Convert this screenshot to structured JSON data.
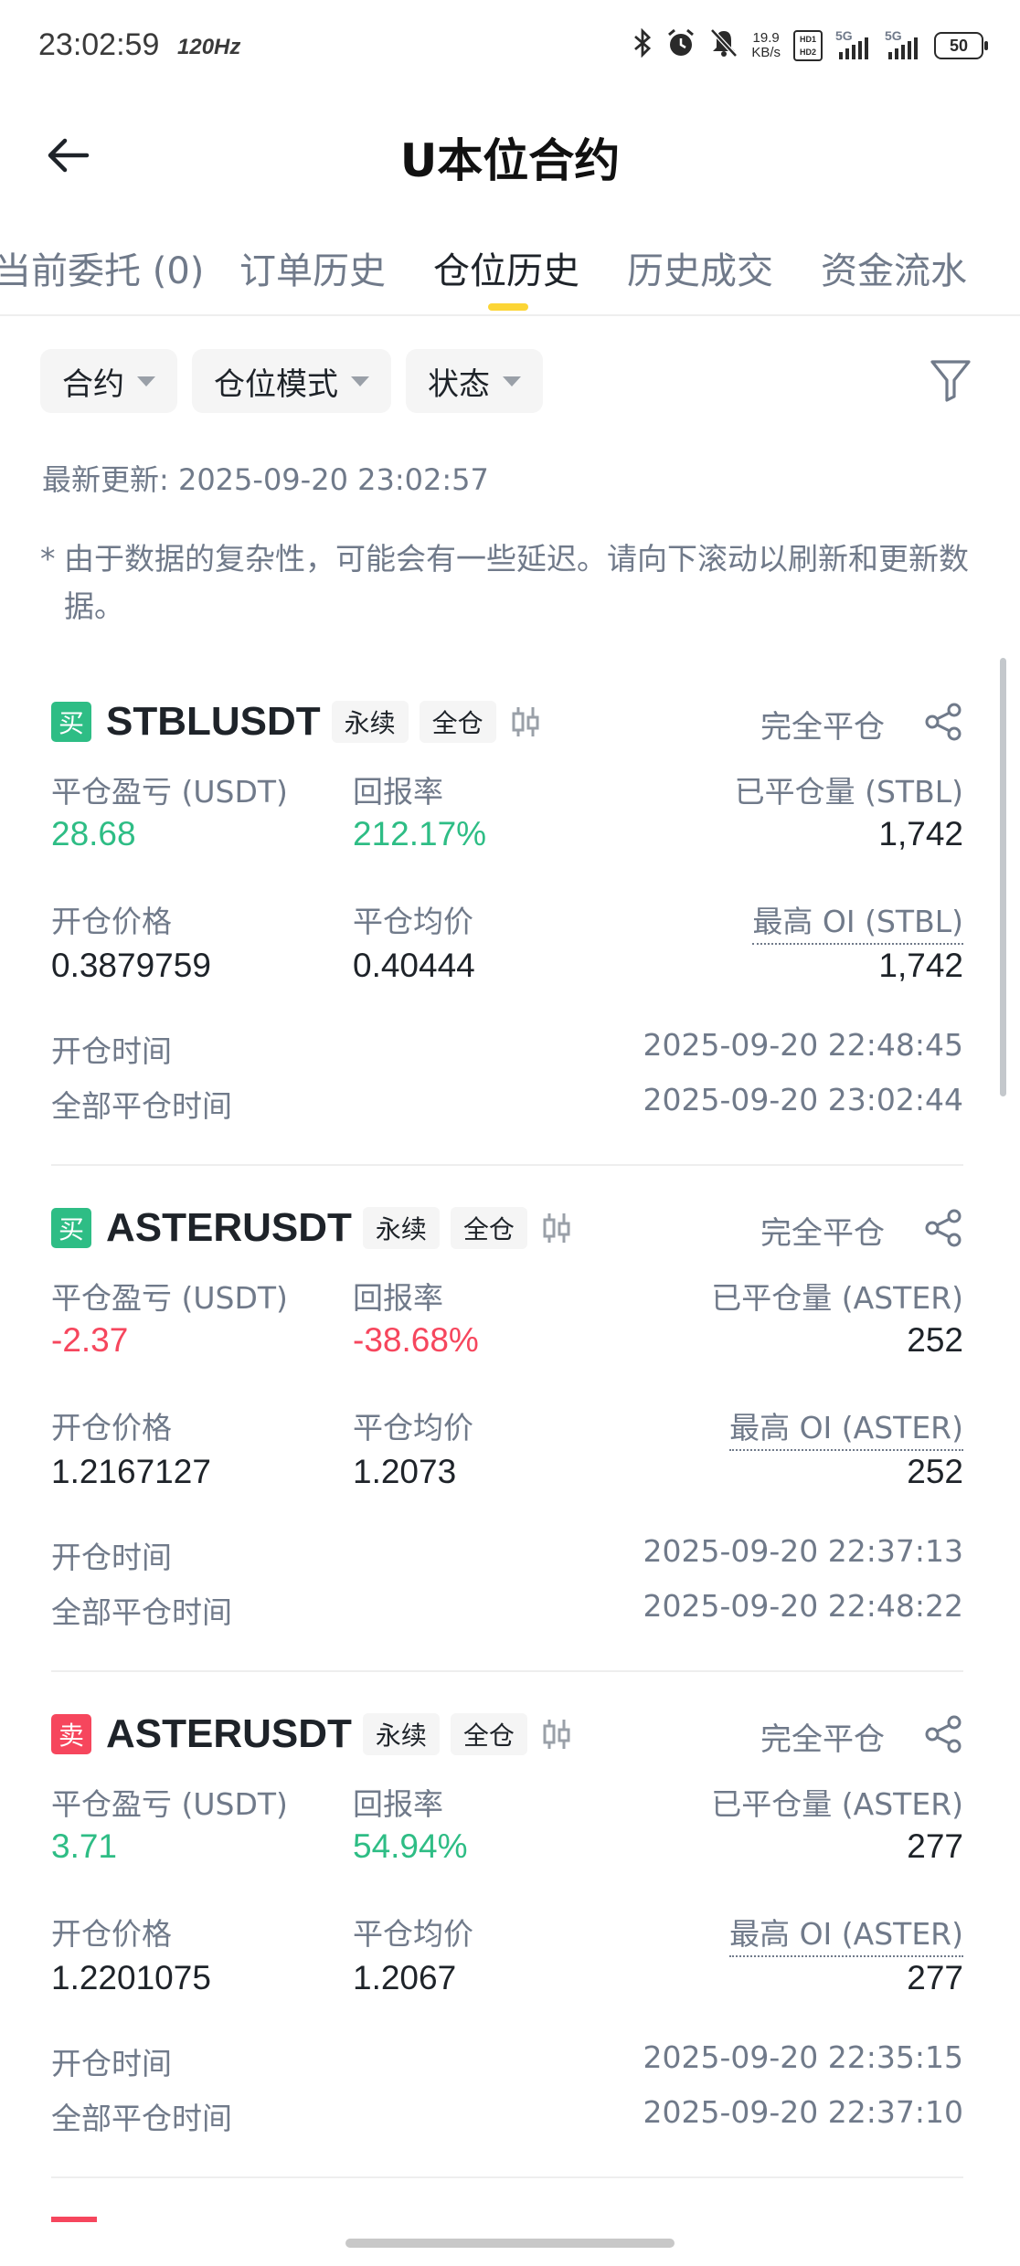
{
  "status_bar": {
    "time": "23:02:59",
    "refresh": "120Hz",
    "net_speed_value": "19.9",
    "net_speed_unit": "KB/s",
    "hd_badge": "HD1 HD2",
    "signal_label": "5G",
    "battery": "50"
  },
  "header": {
    "title": "U本位合约",
    "back_icon": "arrow-left-icon"
  },
  "tabs": [
    {
      "label": "当前委托 (0)"
    },
    {
      "label": "订单历史"
    },
    {
      "label": "仓位历史",
      "active": true
    },
    {
      "label": "历史成交"
    },
    {
      "label": "资金流水"
    }
  ],
  "filters": {
    "contract": "合约",
    "position_mode": "仓位模式",
    "status": "状态"
  },
  "updated": "最新更新: 2025-09-20 23:02:57",
  "note": {
    "star": "*",
    "text": "由于数据的复杂性，可能会有一些延迟。请向下滚动以刷新和更新数据。"
  },
  "labels": {
    "pnl": "平仓盈亏 (USDT)",
    "roi": "回报率",
    "open_price": "开仓价格",
    "close_avg": "平仓均价",
    "open_time": "开仓时间",
    "close_time": "全部平仓时间",
    "perp": "永续",
    "cross": "全仓",
    "status": "完全平仓"
  },
  "positions": [
    {
      "side": "买",
      "side_type": "buy",
      "symbol": "STBLUSDT",
      "pnl": "28.68",
      "roi": "212.17%",
      "closed_qty_label": "已平仓量 (STBL)",
      "closed_qty": "1,742",
      "open_price": "0.3879759",
      "close_avg": "0.40444",
      "max_oi_label": "最高 OI (STBL)",
      "max_oi": "1,742",
      "open_time": "2025-09-20 22:48:45",
      "close_time": "2025-09-20 23:02:44"
    },
    {
      "side": "买",
      "side_type": "buy",
      "symbol": "ASTERUSDT",
      "pnl": "-2.37",
      "roi": "-38.68%",
      "closed_qty_label": "已平仓量 (ASTER)",
      "closed_qty": "252",
      "open_price": "1.2167127",
      "close_avg": "1.2073",
      "max_oi_label": "最高 OI (ASTER)",
      "max_oi": "252",
      "open_time": "2025-09-20 22:37:13",
      "close_time": "2025-09-20 22:48:22"
    },
    {
      "side": "卖",
      "side_type": "sell",
      "symbol": "ASTERUSDT",
      "pnl": "3.71",
      "roi": "54.94%",
      "closed_qty_label": "已平仓量 (ASTER)",
      "closed_qty": "277",
      "open_price": "1.2201075",
      "close_avg": "1.2067",
      "max_oi_label": "最高 OI (ASTER)",
      "max_oi": "277",
      "open_time": "2025-09-20 22:35:15",
      "close_time": "2025-09-20 22:37:10"
    }
  ],
  "colors": {
    "accent": "#fcd535",
    "buy": "#2ebd85",
    "sell": "#f6465d",
    "muted": "#707a8a"
  }
}
